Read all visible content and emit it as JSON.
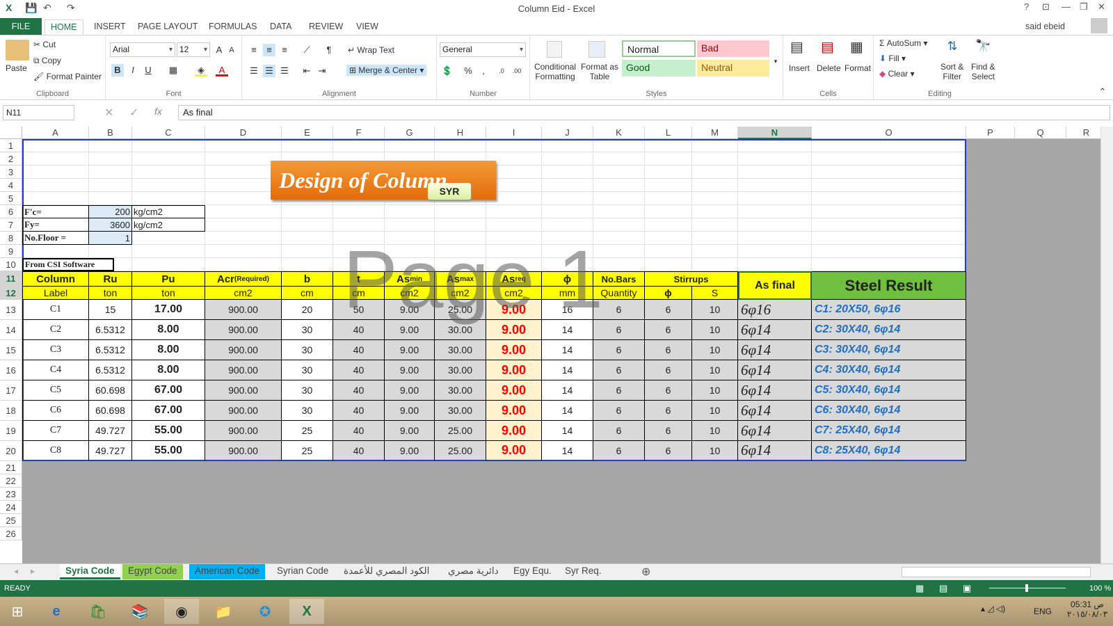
{
  "window": {
    "title": "Column Eid - Excel",
    "user": "said ebeid",
    "help": "?"
  },
  "tabs": [
    "FILE",
    "HOME",
    "INSERT",
    "PAGE LAYOUT",
    "FORMULAS",
    "DATA",
    "REVIEW",
    "VIEW"
  ],
  "ribbon": {
    "clipboard": {
      "paste": "Paste",
      "cut": "Cut",
      "copy": "Copy",
      "format_painter": "Format Painter",
      "label": "Clipboard"
    },
    "font": {
      "name": "Arial",
      "size": "12",
      "label": "Font",
      "bold": "B",
      "italic": "I",
      "underline": "U"
    },
    "alignment": {
      "wrap": "Wrap Text",
      "merge": "Merge & Center",
      "label": "Alignment"
    },
    "number": {
      "format": "General",
      "label": "Number",
      "percent": "%",
      "comma": ","
    },
    "styles": {
      "conditional": "Conditional",
      "conditional2": "Formatting",
      "format_as": "Format as",
      "format_as2": "Table",
      "normal": "Normal",
      "bad": "Bad",
      "good": "Good",
      "neutral": "Neutral",
      "label": "Styles"
    },
    "cells": {
      "insert": "Insert",
      "delete": "Delete",
      "format": "Format",
      "label": "Cells"
    },
    "editing": {
      "autosum": "AutoSum",
      "fill": "Fill",
      "clear": "Clear",
      "sort": "Sort &",
      "sort2": "Filter",
      "find": "Find &",
      "find2": "Select",
      "label": "Editing"
    }
  },
  "formula_bar": {
    "namebox": "N11",
    "value": "As final",
    "fx": "fx"
  },
  "columns": [
    "A",
    "B",
    "C",
    "D",
    "E",
    "F",
    "G",
    "H",
    "I",
    "J",
    "K",
    "L",
    "M",
    "N",
    "O",
    "P",
    "Q",
    "R"
  ],
  "rows": [
    "1",
    "2",
    "3",
    "4",
    "5",
    "6",
    "7",
    "8",
    "9",
    "10",
    "11",
    "12",
    "13",
    "14",
    "15",
    "16",
    "17",
    "18",
    "19",
    "20",
    "21",
    "22",
    "23",
    "24",
    "25",
    "26"
  ],
  "sheet": {
    "banner": "Design of Column",
    "badge": "SYR",
    "watermark": "Page 1",
    "fc_label": "F'c=",
    "fc_value": "200",
    "fc_unit": "kg/cm2",
    "fy_label": "Fy=",
    "fy_value": "3600",
    "fy_unit": "kg/cm2",
    "floor_label": "No.Floor =",
    "floor_value": "1",
    "csi": "From CSI Software",
    "h1": {
      "col": "Column",
      "ru": "Ru",
      "pu": "Pu",
      "acr": "Acr",
      "acr_sub": "(Required)",
      "b": "b",
      "t": "t",
      "asmin": "As",
      "asmin_sub": "min",
      "asmax": "As",
      "asmax_sub": "max",
      "asreq": "As",
      "asreq_sub": "req",
      "phi": "ϕ",
      "nobars": "No.Bars",
      "stirrups": "Stirrups",
      "asfinal": "As final",
      "result": "Steel Result"
    },
    "h2": {
      "col": "Label",
      "ru": "ton",
      "pu": "ton",
      "acr": "cm2",
      "b": "cm",
      "t": "cm",
      "asmin": "cm2",
      "asmax": "cm2",
      "asreq": "cm2",
      "phi": "mm",
      "nobars": "Quantity",
      "sphi": "ϕ",
      "s": "S"
    },
    "data": [
      [
        "C1",
        "15",
        "17.00",
        "900.00",
        "20",
        "50",
        "9.00",
        "25.00",
        "9.00",
        "16",
        "6",
        "6",
        "10",
        "6φ16",
        "C1:  20X50,   6φ16"
      ],
      [
        "C2",
        "6.5312",
        "8.00",
        "900.00",
        "30",
        "40",
        "9.00",
        "30.00",
        "9.00",
        "14",
        "6",
        "6",
        "10",
        "6φ14",
        "C2:  30X40,   6φ14"
      ],
      [
        "C3",
        "6.5312",
        "8.00",
        "900.00",
        "30",
        "40",
        "9.00",
        "30.00",
        "9.00",
        "14",
        "6",
        "6",
        "10",
        "6φ14",
        "C3:  30X40,   6φ14"
      ],
      [
        "C4",
        "6.5312",
        "8.00",
        "900.00",
        "30",
        "40",
        "9.00",
        "30.00",
        "9.00",
        "14",
        "6",
        "6",
        "10",
        "6φ14",
        "C4:  30X40,   6φ14"
      ],
      [
        "C5",
        "60.698",
        "67.00",
        "900.00",
        "30",
        "40",
        "9.00",
        "30.00",
        "9.00",
        "14",
        "6",
        "6",
        "10",
        "6φ14",
        "C5:  30X40,   6φ14"
      ],
      [
        "C6",
        "60.698",
        "67.00",
        "900.00",
        "30",
        "40",
        "9.00",
        "30.00",
        "9.00",
        "14",
        "6",
        "6",
        "10",
        "6φ14",
        "C6:  30X40,   6φ14"
      ],
      [
        "C7",
        "49.727",
        "55.00",
        "900.00",
        "25",
        "40",
        "9.00",
        "25.00",
        "9.00",
        "14",
        "6",
        "6",
        "10",
        "6φ14",
        "C7:  25X40,   6φ14"
      ],
      [
        "C8",
        "49.727",
        "55.00",
        "900.00",
        "25",
        "40",
        "9.00",
        "25.00",
        "9.00",
        "14",
        "6",
        "6",
        "10",
        "6φ14",
        "C8:  25X40,   6φ14"
      ]
    ]
  },
  "sheet_tabs": [
    {
      "label": "Syria Code",
      "color": "#c6efce"
    },
    {
      "label": "Egypt Code",
      "color": "#92d050"
    },
    {
      "label": "American Code",
      "color": "#00b0f0"
    },
    {
      "label": "Syrian Code",
      "color": ""
    },
    {
      "label": "الكود المصري للأعمدة",
      "color": ""
    },
    {
      "label": "دائرية مصري",
      "color": ""
    },
    {
      "label": "Egy Equ.",
      "color": ""
    },
    {
      "label": "Syr Req.",
      "color": ""
    }
  ],
  "status": {
    "ready": "READY",
    "zoom": "100 %"
  },
  "taskbar": {
    "lang": "ENG",
    "time": "05:31 ص",
    "date": "٢٠١٥/٠٨/٠٣"
  }
}
